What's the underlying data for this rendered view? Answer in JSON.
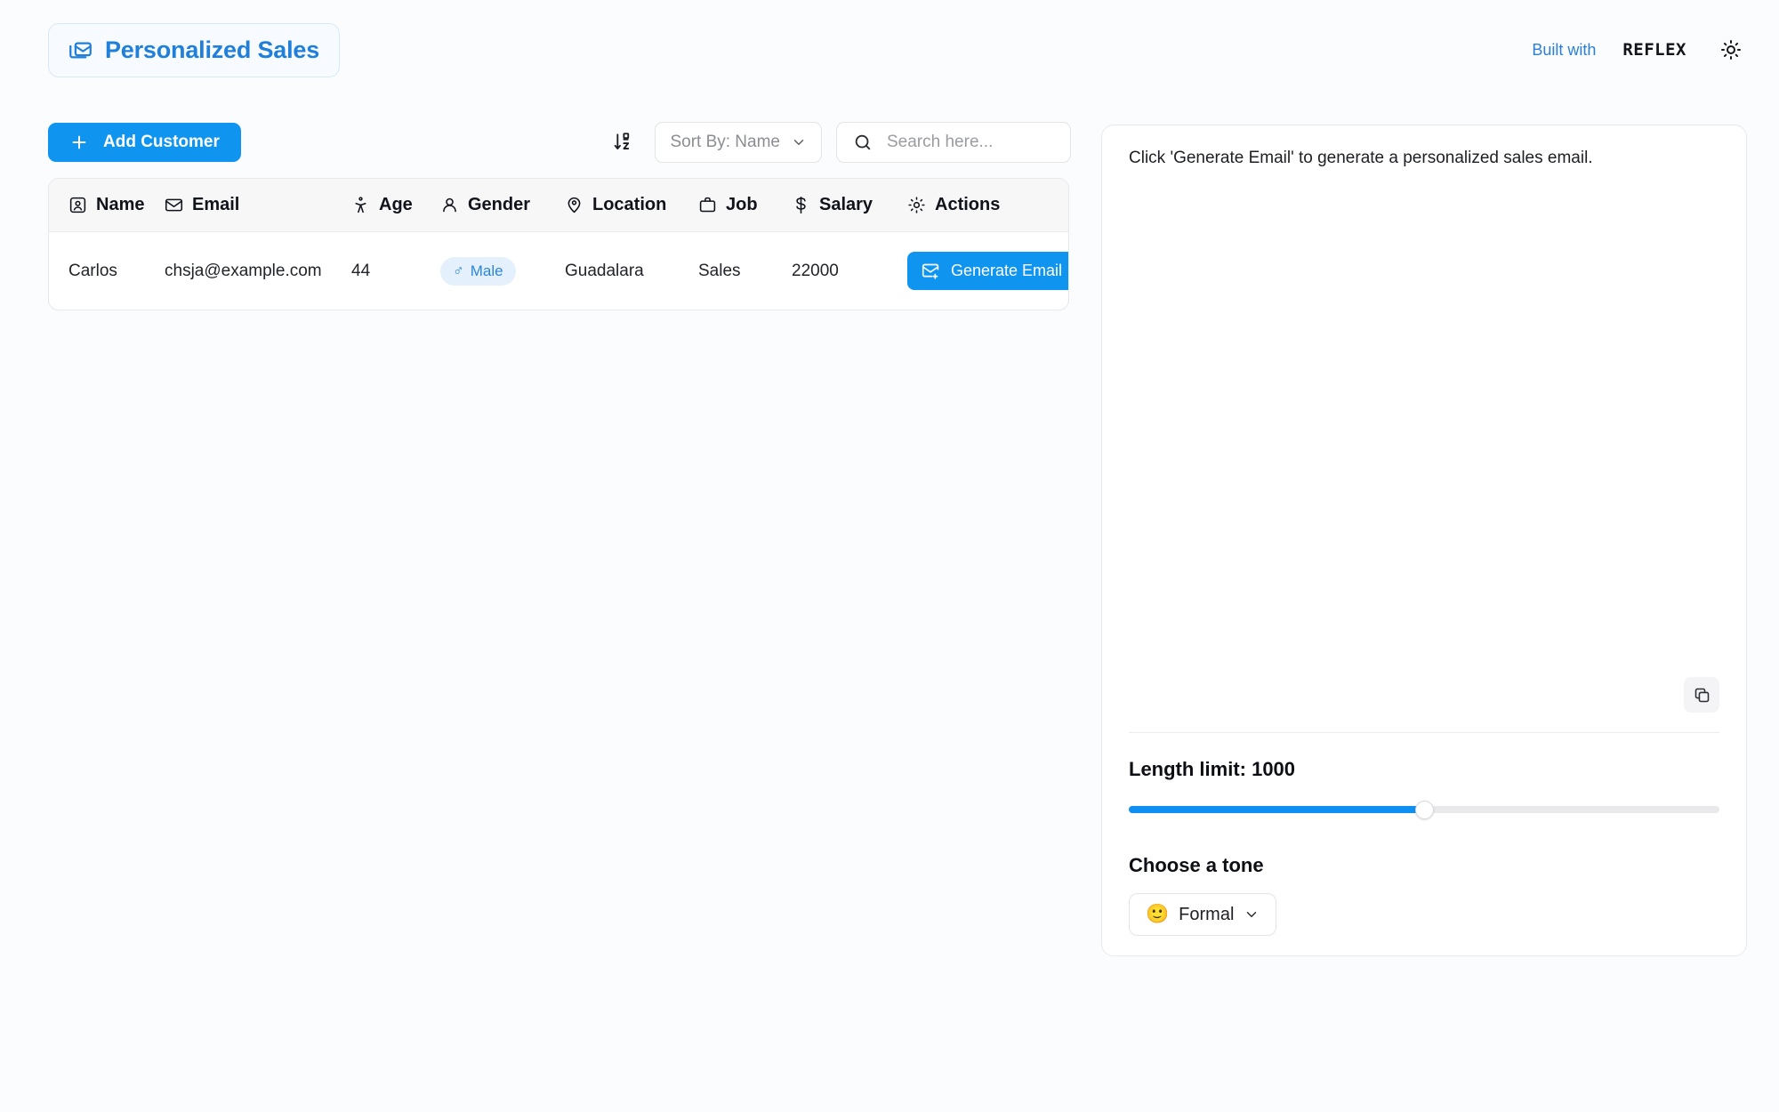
{
  "header": {
    "logo_icon": "mails-icon",
    "logo_text": "Personalized Sales",
    "built_with_label": "Built with",
    "brand_name": "REFLEX",
    "theme_toggle_icon": "sun-icon"
  },
  "toolbar": {
    "add_customer_label": "Add Customer",
    "add_icon": "plus-icon",
    "sort_icon": "arrow-down-az-icon",
    "sort_label": "Sort By: Name",
    "sort_chevron": "chevron-down-icon",
    "search_icon": "search-icon",
    "search_value": "",
    "search_placeholder": "Search here..."
  },
  "table": {
    "columns": [
      {
        "label": "Name",
        "icon": "square-user-icon"
      },
      {
        "label": "Email",
        "icon": "mail-icon"
      },
      {
        "label": "Age",
        "icon": "person-standing-icon"
      },
      {
        "label": "Gender",
        "icon": "user-icon"
      },
      {
        "label": "Location",
        "icon": "map-pin-user-icon"
      },
      {
        "label": "Job",
        "icon": "briefcase-icon"
      },
      {
        "label": "Salary",
        "icon": "dollar-sign-icon"
      },
      {
        "label": "Actions",
        "icon": "cog-icon"
      }
    ],
    "rows": [
      {
        "name": "Carlos",
        "email": "chsja@example.com",
        "age": "44",
        "gender": "Male",
        "gender_symbol": "♂",
        "location": "Guadalara",
        "job": "Sales",
        "salary": "22000",
        "action_label": "Generate Email",
        "action_icon": "mail-plus-icon"
      }
    ]
  },
  "email_panel": {
    "placeholder_text": "Click 'Generate Email' to generate a personalized sales email.",
    "copy_icon": "copy-icon",
    "length_label": "Length limit: 1000",
    "length_value": 1000,
    "length_percent": 50,
    "tone_label": "Choose a tone",
    "tone_emoji": "🙂",
    "tone_value": "Formal",
    "tone_chevron": "chevron-down-icon"
  },
  "colors": {
    "accent": "#0f95f0",
    "logo_blue": "#1f7fdb",
    "badge_bg": "#e4f1fd",
    "badge_text": "#2b86d9",
    "page_bg": "#fbfcfd"
  }
}
